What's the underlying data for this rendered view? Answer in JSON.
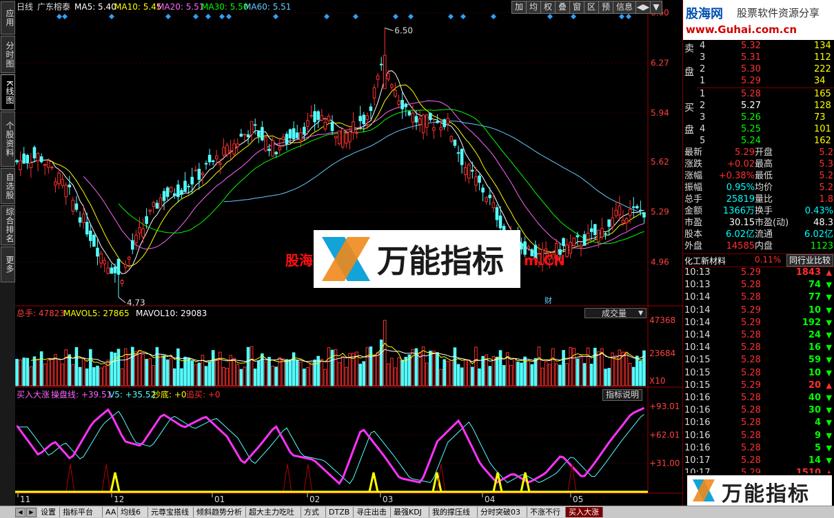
{
  "left_tabs": [
    {
      "label": "应用",
      "active": false
    },
    {
      "label": "分时图",
      "active": false
    },
    {
      "label": "K线图",
      "active": true
    },
    {
      "label": "个股资料",
      "active": false
    },
    {
      "label": "自选股",
      "active": false
    },
    {
      "label": "综合排名",
      "active": false
    },
    {
      "label": "更多",
      "active": false
    }
  ],
  "header": {
    "period": "日线",
    "name": "广东榕泰",
    "ma": [
      {
        "label": "MA5: 5.40",
        "color": "#ffffff"
      },
      {
        "label": "MA10: 5.45",
        "color": "#ffff00"
      },
      {
        "label": "MA20: 5.51",
        "color": "#ff66ff"
      },
      {
        "label": "MA30: 5.50",
        "color": "#00ff00"
      },
      {
        "label": "MA60: 5.51",
        "color": "#66ccff"
      }
    ],
    "toolbar": [
      "加",
      "均",
      "权",
      "叠",
      "窗",
      "区",
      "预",
      "信息",
      "◀▶",
      "▼"
    ]
  },
  "price_axis": [
    "6.60",
    "6.27",
    "5.94",
    "5.62",
    "5.29",
    "4.96"
  ],
  "price_marks": {
    "high": "6.50",
    "low": "4.73",
    "finance_tag": "财"
  },
  "watermark": {
    "left_text": "股海",
    "right_text": "m.CN",
    "logo_text": "万能指标"
  },
  "volume_header": {
    "label": "总手: 47823",
    "mavol5": "MAVOL5: 27865",
    "mavol10": "MAVOL10: 29083",
    "selector": "成交量"
  },
  "volume_axis": [
    "47368",
    "23684",
    "X10"
  ],
  "indicator_header": {
    "name": "买入大涨",
    "line1": "操盘线: +39.51",
    "line2": "V5: +35.52",
    "line3": "抄底: +0",
    "line4": "追买: +0",
    "button": "指标说明"
  },
  "indicator_axis": [
    "+93.01",
    "+62.01",
    "+31.00"
  ],
  "date_axis": [
    "11",
    "12",
    "01",
    "02",
    "03",
    "04",
    "05"
  ],
  "chart_data": {
    "type": "candlestick",
    "title": "广东榕泰 日线",
    "ylim": [
      4.7,
      6.62
    ],
    "high": 6.5,
    "low": 4.73,
    "ma_values": {
      "MA5": 5.4,
      "MA10": 5.45,
      "MA20": 5.51,
      "MA30": 5.5,
      "MA60": 5.51
    },
    "volume": {
      "last": 47823,
      "mavol5": 27865,
      "mavol10": 29083,
      "axis_max": 47368
    },
    "indicator": {
      "操盘线": 39.51,
      "V5": 35.52,
      "抄底": 0,
      "追买": 0,
      "ylim": [
        0,
        93.01
      ]
    },
    "x_months": [
      "11",
      "12",
      "01",
      "02",
      "03",
      "04",
      "05"
    ]
  },
  "right_panel": {
    "logo": {
      "title": "股海网",
      "subtitle": "股票软件资源分享",
      "url": "www.Guhai.com.cn"
    },
    "sell_label": [
      "卖",
      "盘"
    ],
    "buy_label": [
      "买",
      "盘"
    ],
    "sells": [
      {
        "level": "4",
        "price": "5.32",
        "vol": "134"
      },
      {
        "level": "3",
        "price": "5.31",
        "vol": "112"
      },
      {
        "level": "2",
        "price": "5.30",
        "vol": "222"
      },
      {
        "level": "1",
        "price": "5.29",
        "vol": "34"
      }
    ],
    "buys": [
      {
        "level": "1",
        "price": "5.28",
        "vol": "165"
      },
      {
        "level": "2",
        "price": "5.27",
        "vol": "128"
      },
      {
        "level": "3",
        "price": "5.26",
        "vol": "73"
      },
      {
        "level": "4",
        "price": "5.25",
        "vol": "101"
      },
      {
        "level": "5",
        "price": "5.24",
        "vol": "162"
      }
    ],
    "stats": [
      {
        "l1": "最新",
        "v1": "5.29",
        "l2": "开盘",
        "v2": "5.2",
        "c1": "#ff3030",
        "c2": "#ff3030"
      },
      {
        "l1": "涨跌",
        "v1": "+0.02",
        "l2": "最高",
        "v2": "5.3",
        "c1": "#ff3030",
        "c2": "#ff3030"
      },
      {
        "l1": "涨幅",
        "v1": "+0.38%",
        "l2": "最低",
        "v2": "5.2",
        "c1": "#ff3030",
        "c2": "#ff3030"
      },
      {
        "l1": "振幅",
        "v1": "0.95%",
        "l2": "均价",
        "v2": "5.2",
        "c1": "#00ffff",
        "c2": "#ff3030"
      },
      {
        "l1": "总手",
        "v1": "25819",
        "l2": "量比",
        "v2": "1.8",
        "c1": "#00ffff",
        "c2": "#ff3030"
      },
      {
        "l1": "金额",
        "v1": "1366万",
        "l2": "换手",
        "v2": "0.43%",
        "c1": "#00ffff",
        "c2": "#00ffff"
      },
      {
        "l1": "市盈",
        "v1": "30.15",
        "l2": "市盈(动)",
        "v2": "48.3",
        "c1": "#ffffff",
        "c2": "#ffffff"
      },
      {
        "l1": "股本",
        "v1": "6.02亿",
        "l2": "流通",
        "v2": "6.02亿",
        "c1": "#00ffff",
        "c2": "#00ffff"
      },
      {
        "l1": "外盘",
        "v1": "14585",
        "l2": "内盘",
        "v2": "1123",
        "c1": "#ff3030",
        "c2": "#00ff00"
      }
    ],
    "sector": {
      "name": "化工新材料",
      "change": "0.11%",
      "compare": "同行业比较"
    },
    "ticks": [
      {
        "time": "10:13",
        "price": "5.29",
        "vol": "1843",
        "dir": "up"
      },
      {
        "time": "10:13",
        "price": "5.28",
        "vol": "74",
        "dir": "down"
      },
      {
        "time": "10:14",
        "price": "5.28",
        "vol": "77",
        "dir": "down"
      },
      {
        "time": "10:14",
        "price": "5.29",
        "vol": "10",
        "dir": "down"
      },
      {
        "time": "10:14",
        "price": "5.29",
        "vol": "192",
        "dir": "down"
      },
      {
        "time": "10:14",
        "price": "5.28",
        "vol": "24",
        "dir": "down"
      },
      {
        "time": "10:14",
        "price": "5.28",
        "vol": "16",
        "dir": "down"
      },
      {
        "time": "10:15",
        "price": "5.28",
        "vol": "59",
        "dir": "down"
      },
      {
        "time": "10:15",
        "price": "5.28",
        "vol": "10",
        "dir": "down"
      },
      {
        "time": "10:15",
        "price": "5.29",
        "vol": "20",
        "dir": "up"
      },
      {
        "time": "10:16",
        "price": "5.28",
        "vol": "40",
        "dir": "down"
      },
      {
        "time": "10:16",
        "price": "5.28",
        "vol": "30",
        "dir": "down"
      },
      {
        "time": "10:16",
        "price": "5.28",
        "vol": "4",
        "dir": "down"
      },
      {
        "time": "10:16",
        "price": "5.28",
        "vol": "9",
        "dir": "down"
      },
      {
        "time": "10:16",
        "price": "5.28",
        "vol": "5",
        "dir": "down"
      },
      {
        "time": "10:17",
        "price": "5.28",
        "vol": "14",
        "dir": "down"
      },
      {
        "time": "10:17",
        "price": "5.29",
        "vol": "1510",
        "dir": "up"
      }
    ],
    "bottom_logo": "万能指标"
  },
  "bottom_tabs": [
    "设置",
    "指标平台",
    "AA",
    "均线6",
    "元尊宝搭线",
    "倾斜趋势分析",
    "超大主力吃吐",
    "方式",
    "DTZB",
    "寻庄出击",
    "最强KDJ",
    "我的撑压线",
    "分时突破03",
    "不涨不行",
    "买入大涨"
  ],
  "bottom_active": "买入大涨"
}
